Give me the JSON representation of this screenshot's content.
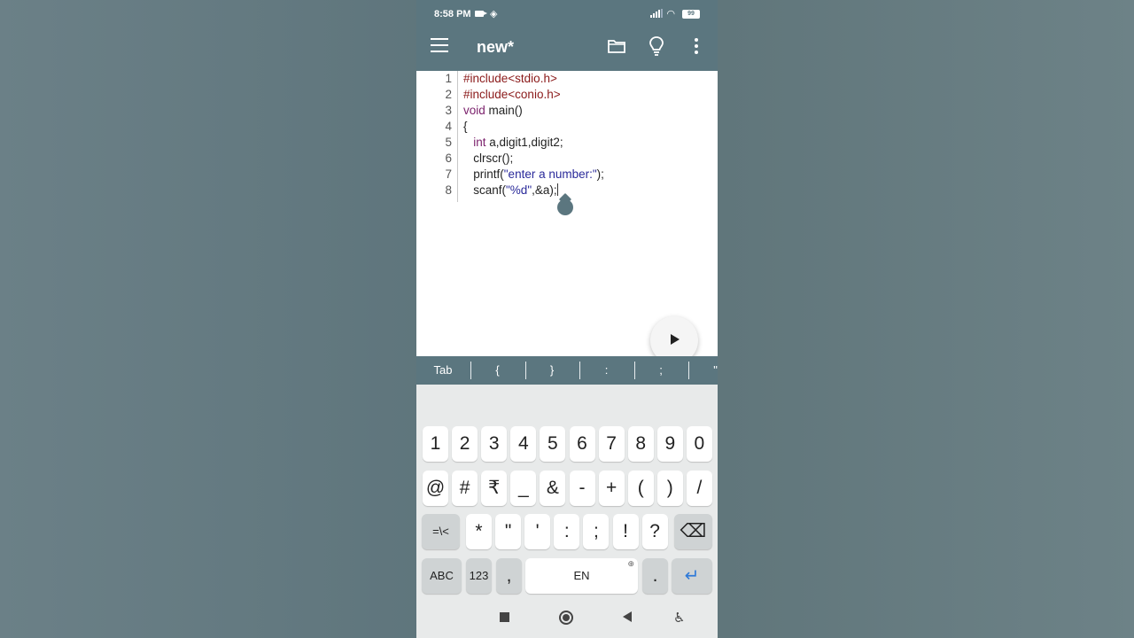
{
  "status_bar": {
    "time": "8:58 PM",
    "battery": "99"
  },
  "app_bar": {
    "title": "new*",
    "icons": [
      "menu-icon",
      "folder-icon",
      "lightbulb-icon",
      "more-vert-icon"
    ]
  },
  "editor": {
    "lines": [
      {
        "num": "1",
        "segments": [
          {
            "t": "#include<stdio.h>",
            "c": "kw-pp"
          }
        ]
      },
      {
        "num": "2",
        "segments": [
          {
            "t": "#include<conio.h>",
            "c": "kw-pp"
          }
        ]
      },
      {
        "num": "3",
        "segments": [
          {
            "t": "void",
            "c": "kw"
          },
          {
            "t": " main()",
            "c": ""
          }
        ]
      },
      {
        "num": "4",
        "segments": [
          {
            "t": "{",
            "c": ""
          }
        ]
      },
      {
        "num": "5",
        "segments": [
          {
            "t": "   int",
            "c": "kw"
          },
          {
            "t": " a,digit1,digit2;",
            "c": ""
          }
        ]
      },
      {
        "num": "6",
        "segments": [
          {
            "t": "   clrscr();",
            "c": ""
          }
        ]
      },
      {
        "num": "7",
        "segments": [
          {
            "t": "   printf(",
            "c": ""
          },
          {
            "t": "\"enter a number:\"",
            "c": "str"
          },
          {
            "t": ");",
            "c": ""
          }
        ]
      },
      {
        "num": "8",
        "segments": [
          {
            "t": "   scanf(",
            "c": ""
          },
          {
            "t": "\"%d\"",
            "c": "str"
          },
          {
            "t": ",&a);",
            "c": ""
          }
        ]
      }
    ],
    "run_icon": "play-icon"
  },
  "symbol_bar": [
    "Tab",
    "{",
    "}",
    ":",
    ";",
    "\""
  ],
  "keyboard": {
    "row1": [
      "1",
      "2",
      "3",
      "4",
      "5",
      "6",
      "7",
      "8",
      "9",
      "0"
    ],
    "row2": [
      "@",
      "#",
      "₹",
      "_",
      "&",
      "-",
      "+",
      "(",
      ")",
      "/"
    ],
    "row3": [
      "=\\<",
      "*",
      "\"",
      "'",
      ":",
      ";",
      "!",
      "?",
      "⌫"
    ],
    "row4": [
      "ABC",
      "123",
      ",",
      "EN",
      ".",
      "↵"
    ]
  },
  "colors": {
    "primary": "#5b767f",
    "enter_accent": "#2f7ad8",
    "preprocessor": "#8b1a1a",
    "keyword": "#7a1f6b",
    "string": "#2a2a9a"
  }
}
